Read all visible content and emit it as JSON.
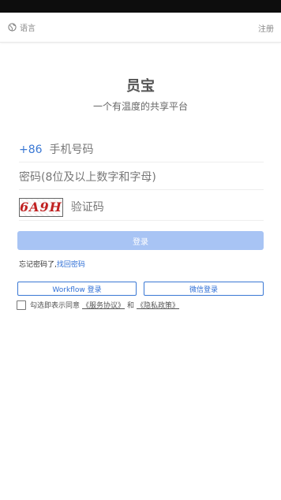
{
  "topbar": {
    "language_label": "语言",
    "register_label": "注册"
  },
  "app": {
    "title": "员宝",
    "slogan": "一个有温度的共享平台"
  },
  "form": {
    "country_code": "+86",
    "phone_placeholder": "手机号码",
    "password_placeholder": "密码(8位及以上数字和字母)",
    "captcha_text": "6A9H",
    "captcha_placeholder": "验证码",
    "login_label": "登录"
  },
  "forgot": {
    "prefix": "忘记密码了,",
    "link": "找回密码"
  },
  "alt_login": {
    "workflow_label": "Workflow 登录",
    "wechat_label": "微信登录"
  },
  "agreement": {
    "prefix": "勾选即表示同意",
    "service": "《服务协议》",
    "and": "和",
    "privacy": "《隐私政策》"
  },
  "colors": {
    "accent": "#3a78d4",
    "login_button": "#a8c4f4",
    "status_bar": "#0d0d0d"
  },
  "icons": {
    "language": "globe-icon"
  }
}
